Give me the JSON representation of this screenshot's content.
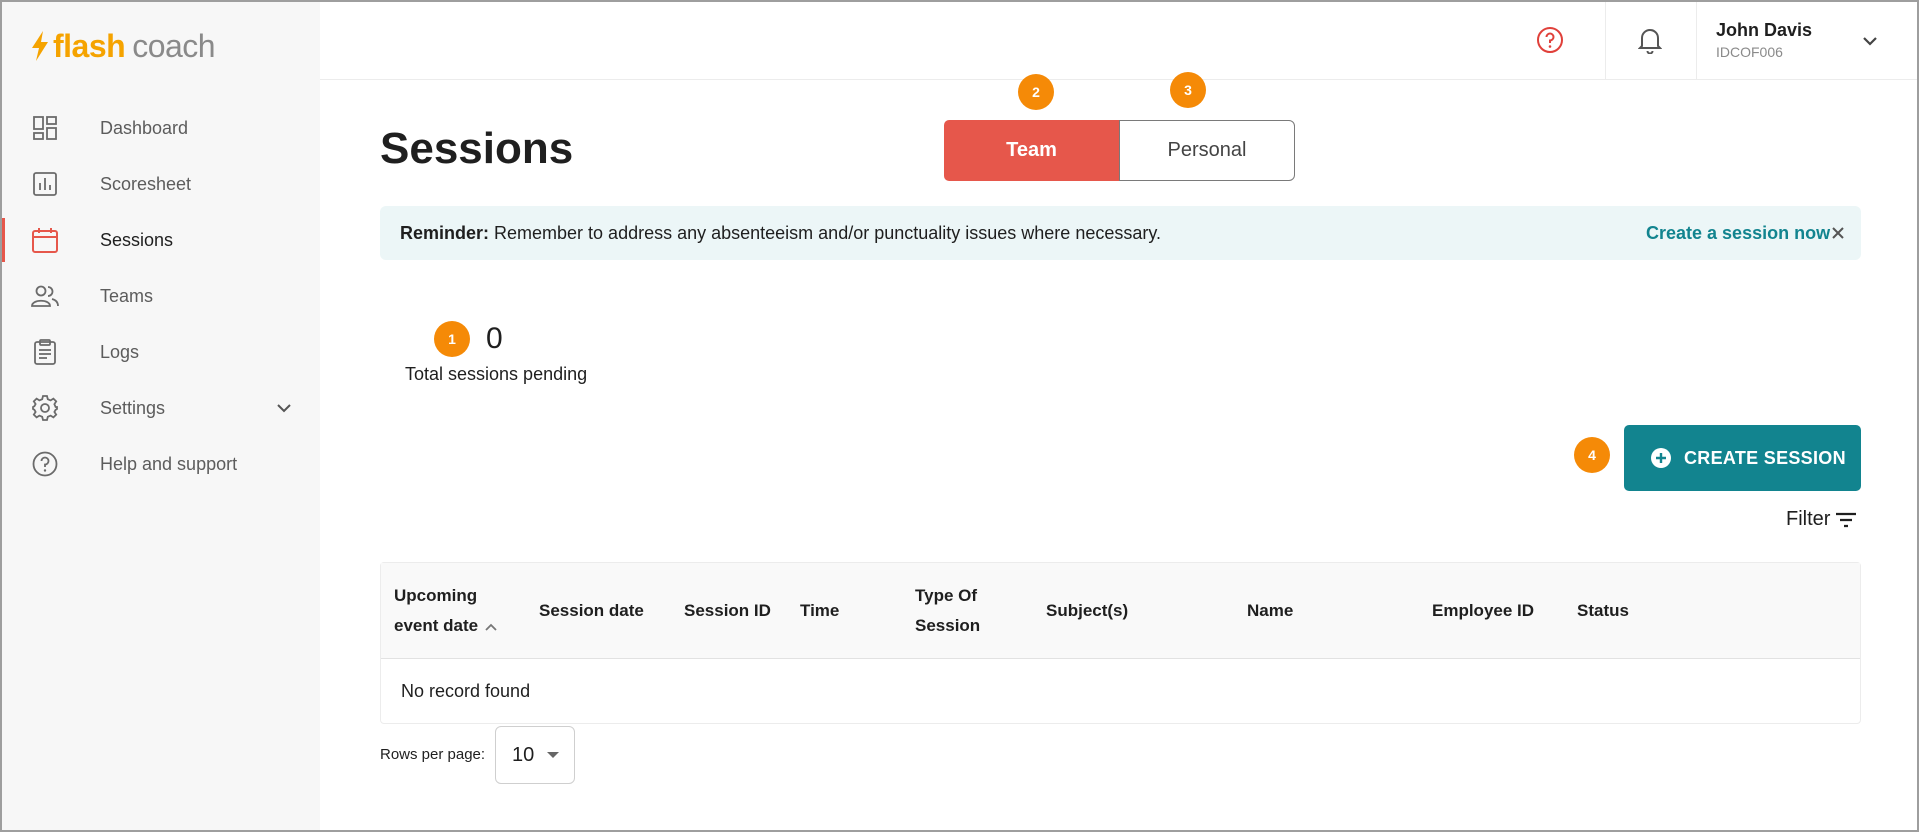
{
  "brand": {
    "name_part1": "flash",
    "name_part2": "coach",
    "accent": "#f5a300"
  },
  "sidebar": {
    "items": [
      {
        "label": "Dashboard",
        "icon": "dashboard-icon",
        "active": false
      },
      {
        "label": "Scoresheet",
        "icon": "bar-chart-icon",
        "active": false
      },
      {
        "label": "Sessions",
        "icon": "calendar-icon",
        "active": true
      },
      {
        "label": "Teams",
        "icon": "people-icon",
        "active": false
      },
      {
        "label": "Logs",
        "icon": "clipboard-icon",
        "active": false
      },
      {
        "label": "Settings",
        "icon": "gear-icon",
        "active": false,
        "expandable": true
      },
      {
        "label": "Help and support",
        "icon": "help-circle-icon",
        "active": false
      }
    ]
  },
  "topbar": {
    "user_name": "John Davis",
    "user_id": "IDCOF006"
  },
  "page": {
    "title": "Sessions",
    "toggle": {
      "team_label": "Team",
      "personal_label": "Personal",
      "selected": "Team"
    }
  },
  "reminder": {
    "prefix": "Reminder:",
    "text": " Remember to address any absenteeism and/or punctuality issues where necessary.",
    "link": "Create a session now"
  },
  "stats": {
    "pending_count": "0",
    "pending_label": "Total sessions pending"
  },
  "actions": {
    "create_label": "CREATE SESSION",
    "filter_label": "Filter"
  },
  "table": {
    "columns": [
      {
        "line1": "Upcoming",
        "line2": "event date"
      },
      {
        "line1": "Session date"
      },
      {
        "line1": "Session ID"
      },
      {
        "line1": "Time"
      },
      {
        "line1": "Type Of",
        "line2": "Session"
      },
      {
        "line1": "Subject(s)"
      },
      {
        "line1": "Name"
      },
      {
        "line1": "Employee ID"
      },
      {
        "line1": "Status"
      }
    ],
    "empty_text": "No record found"
  },
  "pagination": {
    "rows_label": "Rows per page:",
    "rows_value": "10"
  },
  "markers": [
    "1",
    "2",
    "3",
    "4"
  ],
  "colors": {
    "primary": "#12848f",
    "accent_red": "#e6574b",
    "marker_orange": "#f58a07"
  }
}
